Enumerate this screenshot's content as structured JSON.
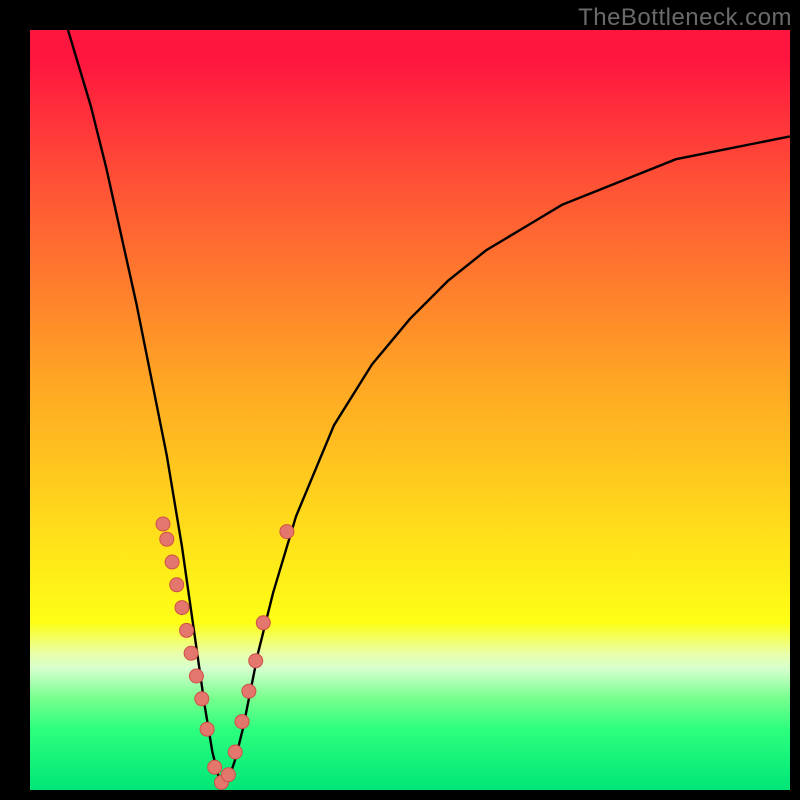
{
  "watermark": "TheBottleneck.com",
  "colors": {
    "page_bg": "#000000",
    "curve": "#000000",
    "dot_fill": "#e4776d",
    "dot_stroke": "#cf4f47"
  },
  "chart_data": {
    "type": "line",
    "title": "",
    "xlabel": "",
    "ylabel": "",
    "xlim": [
      0,
      100
    ],
    "ylim": [
      0,
      100
    ],
    "grid": false,
    "legend": false,
    "note": "Axes unlabeled. Values estimated: x roughly 0–100 left→right, y roughly 0–100 with 0 at bottom (green) and 100 at top (red). Curve is a V-shaped dip to ~0 near x≈25 then rising asymptotically toward the right.",
    "series": [
      {
        "name": "bottleneck-curve",
        "x": [
          5,
          8,
          10,
          12,
          14,
          16,
          18,
          19,
          20,
          21,
          22,
          23,
          24,
          25,
          26,
          27,
          28,
          29,
          30,
          32,
          35,
          40,
          45,
          50,
          55,
          60,
          65,
          70,
          75,
          80,
          85,
          90,
          95,
          100
        ],
        "y": [
          100,
          90,
          82,
          73,
          64,
          54,
          44,
          38,
          32,
          25,
          18,
          11,
          5,
          1,
          1,
          4,
          8,
          13,
          18,
          26,
          36,
          48,
          56,
          62,
          67,
          71,
          74,
          77,
          79,
          81,
          83,
          84,
          85,
          86
        ]
      }
    ],
    "scatter_points": {
      "name": "highlighted-dots",
      "note": "Salmon dots clustered along the lower portion of both arms of the V, roughly y ≤ 35.",
      "x": [
        17.5,
        18,
        18.7,
        19.3,
        20,
        20.6,
        21.2,
        21.9,
        22.6,
        23.3,
        24.3,
        25.2,
        26.1,
        27,
        27.9,
        28.8,
        29.7,
        30.7,
        33.8
      ],
      "y": [
        35,
        33,
        30,
        27,
        24,
        21,
        18,
        15,
        12,
        8,
        3,
        1,
        2,
        5,
        9,
        13,
        17,
        22,
        34
      ]
    }
  }
}
